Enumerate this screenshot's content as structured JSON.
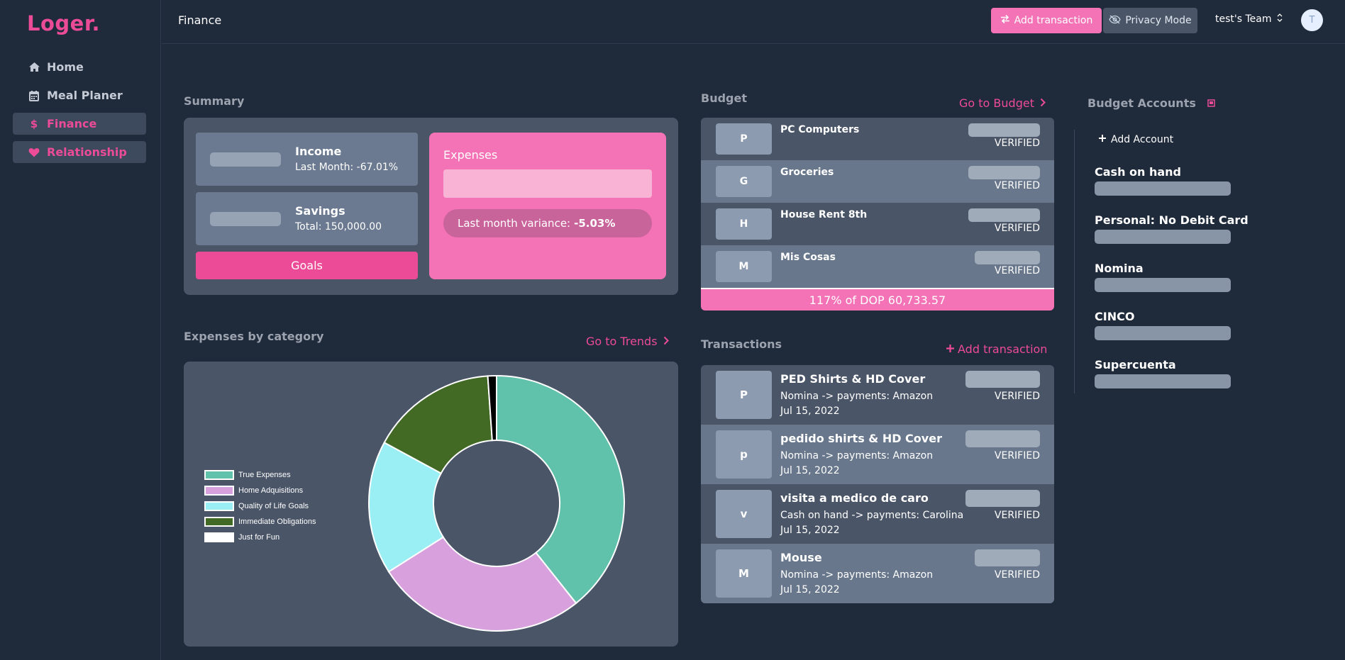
{
  "app": {
    "logo": "Loger."
  },
  "sidebar": {
    "items": [
      {
        "label": "Home",
        "icon": "home-icon"
      },
      {
        "label": "Meal Planer",
        "icon": "calendar-icon"
      },
      {
        "label": "Finance",
        "icon": "dollar-icon"
      },
      {
        "label": "Relationship",
        "icon": "heart-icon"
      }
    ]
  },
  "header": {
    "title": "Finance",
    "add_transaction": "Add transaction",
    "privacy_mode": "Privacy Mode",
    "team": "test's Team",
    "avatar": "T"
  },
  "summary": {
    "title": "Summary",
    "income_label": "Income",
    "income_sub": "Last Month: -67.01%",
    "savings_label": "Savings",
    "savings_sub": "Total: 150,000.00",
    "goals_button": "Goals",
    "expenses_label": "Expenses",
    "variance_label": "Last month variance:",
    "variance_value": "-5.03%"
  },
  "expenses_chart": {
    "title": "Expenses by category",
    "link": "Go to Trends"
  },
  "chart_data": {
    "type": "pie",
    "categories": [
      "True Expenses",
      "Home Adquisitions",
      "Quality of Life Goals",
      "Immediate Obligations",
      "Just for Fun"
    ],
    "values": [
      39.3,
      26.7,
      16.9,
      16.0,
      1.1
    ],
    "colors": [
      "#61c2ab",
      "#d8a0dc",
      "#9aeff5",
      "#426a25",
      "#000000"
    ],
    "legend_swatch_colors": [
      "#61c2ab",
      "#d8a0dc",
      "#9aeff5",
      "#426a25",
      "#ffffff"
    ],
    "legend_position": "left",
    "donut": true
  },
  "budget": {
    "title": "Budget",
    "link": "Go to Budget",
    "items": [
      {
        "letter": "P",
        "name": "PC Computers",
        "status": "VERIFIED"
      },
      {
        "letter": "G",
        "name": "Groceries",
        "status": "VERIFIED"
      },
      {
        "letter": "H",
        "name": "House Rent 8th",
        "status": "VERIFIED"
      },
      {
        "letter": "M",
        "name": "Mis Cosas",
        "status": "VERIFIED"
      }
    ],
    "footer": "117% of DOP 60,733.57"
  },
  "transactions": {
    "title": "Transactions",
    "add_link": "Add transaction",
    "items": [
      {
        "letter": "P",
        "name": "PED Shirts & HD Cover",
        "path": "Nomina -> payments: Amazon",
        "date": "Jul 15, 2022",
        "status": "VERIFIED"
      },
      {
        "letter": "p",
        "name": "pedido shirts & HD Cover",
        "path": "Nomina -> payments: Amazon",
        "date": "Jul 15, 2022",
        "status": "VERIFIED"
      },
      {
        "letter": "v",
        "name": "visita a medico de caro",
        "path": "Cash on hand -> payments: Carolina",
        "date": "Jul 15, 2022",
        "status": "VERIFIED"
      },
      {
        "letter": "M",
        "name": "Mouse",
        "path": "Nomina -> payments: Amazon",
        "date": "Jul 15, 2022",
        "status": "VERIFIED"
      }
    ]
  },
  "accounts": {
    "title": "Budget Accounts",
    "add_label": "Add Account",
    "items": [
      {
        "name": "Cash on hand"
      },
      {
        "name": "Personal: No Debit Card"
      },
      {
        "name": "Nomina"
      },
      {
        "name": "CINCO"
      },
      {
        "name": "Supercuenta"
      }
    ]
  },
  "colors": {
    "accent": "#ec4b97",
    "accent_light": "#f472b6",
    "bg": "#1f2a3b",
    "card": "#4a5568"
  }
}
